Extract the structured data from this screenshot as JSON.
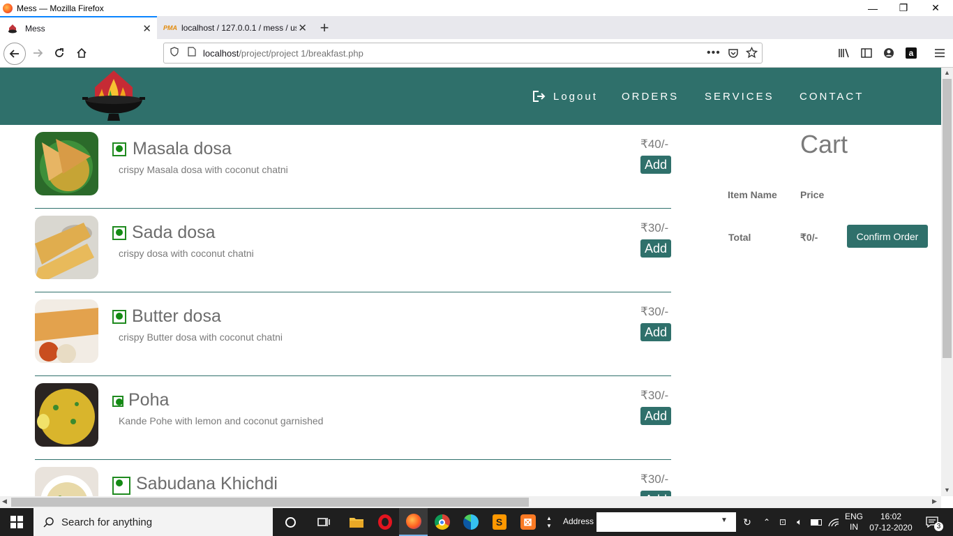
{
  "window": {
    "title": "Mess — Mozilla Firefox",
    "minimize": "—",
    "restore": "❐",
    "close": "✕"
  },
  "tabs": [
    {
      "label": "Mess",
      "close": "✕"
    },
    {
      "label": "localhost / 127.0.0.1 / mess / us",
      "close": "✕"
    }
  ],
  "newtab": "+",
  "address": {
    "host": "localhost",
    "path": "/project/project 1/breakfast.php"
  },
  "site": {
    "nav": {
      "logout": "Logout",
      "orders": "ORDERS",
      "services": "SERVICES",
      "contact": "CONTACT"
    }
  },
  "menu": [
    {
      "name": "Masala dosa",
      "desc": "crispy Masala dosa with coconut chatni",
      "price": "₹40/-",
      "add": "Add"
    },
    {
      "name": "Sada dosa",
      "desc": "crispy dosa with coconut chatni",
      "price": "₹30/-",
      "add": "Add"
    },
    {
      "name": "Butter dosa",
      "desc": "crispy Butter dosa with coconut chatni",
      "price": "₹30/-",
      "add": "Add"
    },
    {
      "name": "Poha",
      "desc": "Kande Pohe with lemon and coconut garnished",
      "price": "₹30/-",
      "add": "Add"
    },
    {
      "name": "Sabudana Khichdi",
      "desc": "",
      "price": "₹30/-",
      "add": "Add"
    }
  ],
  "cart": {
    "title": "Cart",
    "col_item": "Item Name",
    "col_price": "Price",
    "total_label": "Total",
    "total_value": "₹0/-",
    "confirm": "Confirm Order"
  },
  "taskbar": {
    "search_placeholder": "Search for anything",
    "address_label": "Address",
    "lang_top": "ENG",
    "lang_bottom": "IN",
    "time": "16:02",
    "date": "07-12-2020",
    "notifications": "3"
  },
  "colors": {
    "brand": "#2f706b",
    "veg": "#138a13"
  }
}
